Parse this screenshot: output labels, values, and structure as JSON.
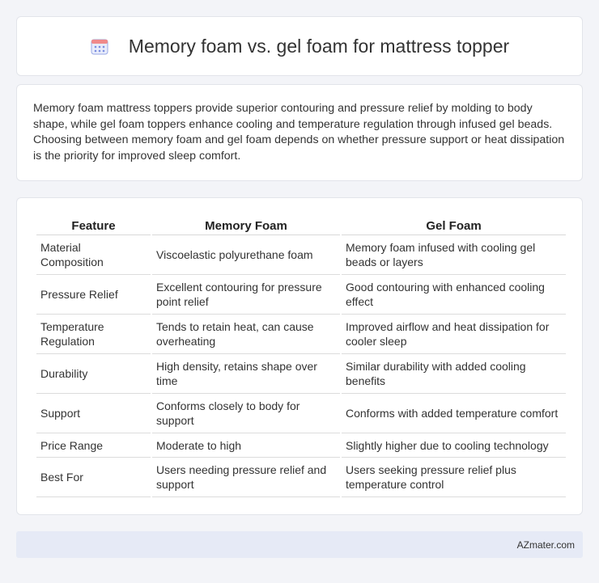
{
  "header": {
    "title": "Memory foam vs. gel foam for mattress topper",
    "icon": "calendar-icon"
  },
  "summary": {
    "text": "Memory foam mattress toppers provide superior contouring and pressure relief by molding to body shape, while gel foam toppers enhance cooling and temperature regulation through infused gel beads. Choosing between memory foam and gel foam depends on whether pressure support or heat dissipation is the priority for improved sleep comfort."
  },
  "table": {
    "headers": [
      "Feature",
      "Memory Foam",
      "Gel Foam"
    ],
    "rows": [
      [
        "Material Composition",
        "Viscoelastic polyurethane foam",
        "Memory foam infused with cooling gel beads or layers"
      ],
      [
        "Pressure Relief",
        "Excellent contouring for pressure point relief",
        "Good contouring with enhanced cooling effect"
      ],
      [
        "Temperature Regulation",
        "Tends to retain heat, can cause overheating",
        "Improved airflow and heat dissipation for cooler sleep"
      ],
      [
        "Durability",
        "High density, retains shape over time",
        "Similar durability with added cooling benefits"
      ],
      [
        "Support",
        "Conforms closely to body for support",
        "Conforms with added temperature comfort"
      ],
      [
        "Price Range",
        "Moderate to high",
        "Slightly higher due to cooling technology"
      ],
      [
        "Best For",
        "Users needing pressure relief and support",
        "Users seeking pressure relief plus temperature control"
      ]
    ]
  },
  "footer": {
    "text": "AZmater.com"
  },
  "colors": {
    "background": "#f3f4f8",
    "footer_bg": "#e6eaf6",
    "icon_accent": "#6a7fd6"
  }
}
